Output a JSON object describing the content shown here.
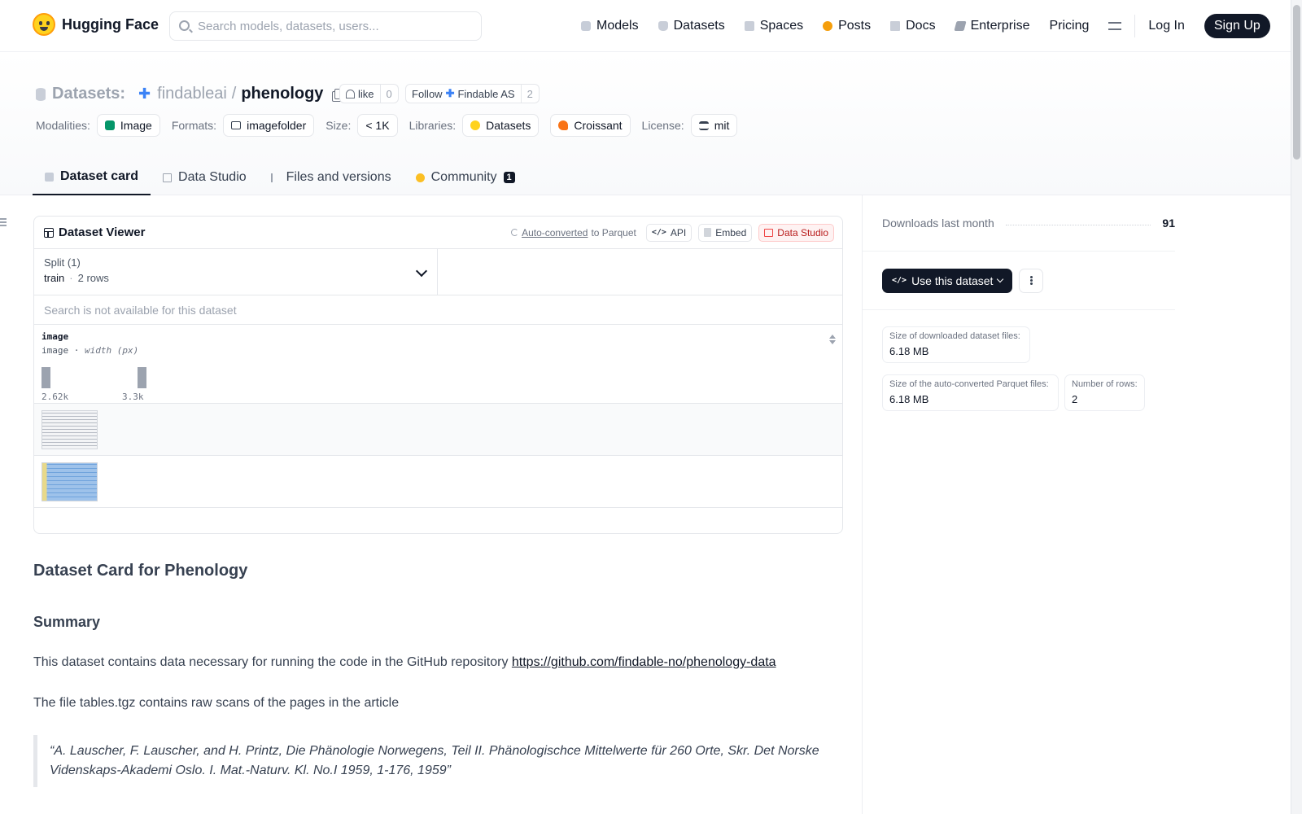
{
  "nav": {
    "brand": "Hugging Face",
    "search_placeholder": "Search models, datasets, users...",
    "links": [
      "Models",
      "Datasets",
      "Spaces",
      "Posts",
      "Docs",
      "Enterprise",
      "Pricing"
    ],
    "login": "Log In",
    "signup": "Sign Up"
  },
  "repo": {
    "section": "Datasets:",
    "org": "findableai",
    "separator": "/",
    "name": "phenology",
    "like_label": "like",
    "like_count": "0",
    "follow_label": "Follow",
    "follow_org": "Findable AS",
    "follow_count": "2"
  },
  "meta": {
    "modalities_label": "Modalities:",
    "modality": "Image",
    "formats_label": "Formats:",
    "format": "imagefolder",
    "size_label": "Size:",
    "size": "< 1K",
    "libraries_label": "Libraries:",
    "libraries": [
      "Datasets",
      "Croissant"
    ],
    "license_label": "License:",
    "license": "mit"
  },
  "tabs": [
    {
      "label": "Dataset card",
      "active": true
    },
    {
      "label": "Data Studio"
    },
    {
      "label": "Files and versions"
    },
    {
      "label": "Community",
      "badge": "1"
    }
  ],
  "viewer": {
    "title": "Dataset Viewer",
    "auto_converted": "Auto-converted",
    "to_parquet": "to Parquet",
    "api": "API",
    "embed": "Embed",
    "data_studio": "Data Studio",
    "split_label": "Split (1)",
    "split_value": "train",
    "split_sep": "·",
    "split_rows": "2 rows",
    "search_placeholder": "Search is not available for this dataset",
    "column": {
      "name": "image",
      "type": "image",
      "type_sep": "·",
      "subtype": "width (px)",
      "hist_min": "2.62k",
      "hist_max": "3.3k",
      "hist_values": [
        1,
        1
      ]
    },
    "row_count": 2
  },
  "card": {
    "title": "Dataset Card for Phenology",
    "summary_heading": "Summary",
    "para1_text": "This dataset contains data necessary for running the code in the GitHub repository",
    "para1_link": "https://github.com/findable-no/phenology-data",
    "para2": "The file tables.tgz contains raw scans of the pages in the article",
    "quote": "“A. Lauscher, F. Lauscher, and H. Printz, Die Phänologie Norwegens, Teil II. Phänologischce Mittelwerte für 260 Orte, Skr. Det Norske Videnskaps-Akademi Oslo. I. Mat.-Naturv. Kl. No.I 1959, 1-176, 1959”"
  },
  "sidebar": {
    "downloads_label": "Downloads last month",
    "downloads_value": "91",
    "use_button": "Use this dataset",
    "stats": [
      {
        "label": "Size of downloaded dataset files:",
        "value": "6.18 MB"
      },
      {
        "label": "Size of the auto-converted Parquet files:",
        "value": "6.18 MB"
      },
      {
        "label": "Number of rows:",
        "value": "2"
      }
    ]
  }
}
